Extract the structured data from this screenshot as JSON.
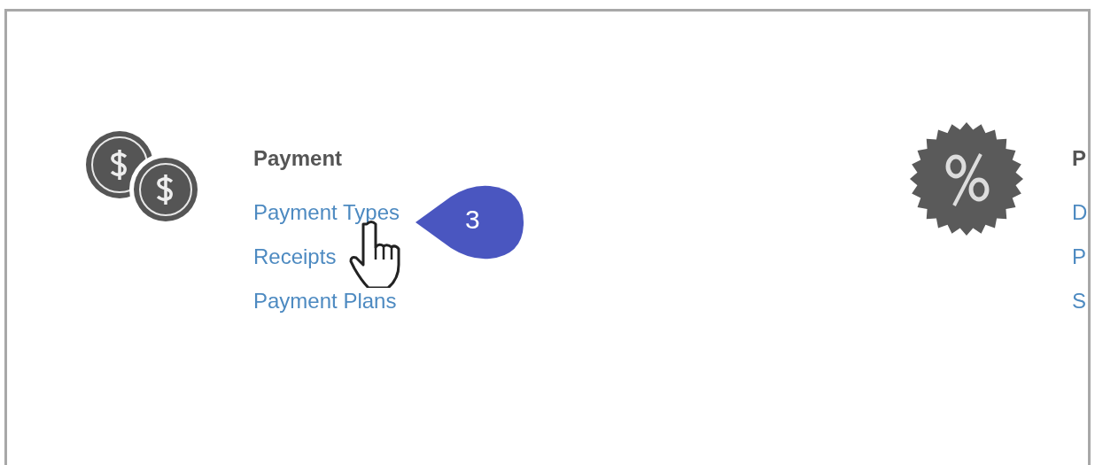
{
  "sections": [
    {
      "heading": "Payment",
      "links": [
        "Payment Types",
        "Receipts",
        "Payment Plans"
      ]
    },
    {
      "heading": "P",
      "links": [
        "D",
        "P",
        "S"
      ]
    }
  ],
  "callout": {
    "label": "3"
  }
}
